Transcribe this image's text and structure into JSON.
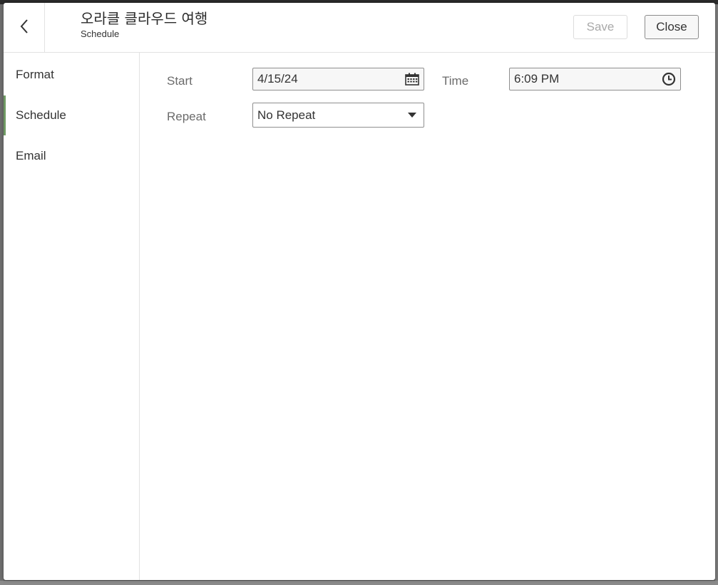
{
  "header": {
    "title": "오라클 클라우드 여행",
    "subtitle": "Schedule",
    "save_label": "Save",
    "close_label": "Close"
  },
  "sidebar": {
    "items": [
      {
        "label": "Format",
        "active": false
      },
      {
        "label": "Schedule",
        "active": true
      },
      {
        "label": "Email",
        "active": false
      }
    ]
  },
  "form": {
    "start_label": "Start",
    "start_value": "4/15/24",
    "time_label": "Time",
    "time_value": "6:09 PM",
    "repeat_label": "Repeat",
    "repeat_value": "No Repeat"
  },
  "icons": {
    "back": "chevron-left-icon",
    "calendar": "calendar-icon",
    "clock": "clock-icon",
    "dropdown": "caret-down-icon"
  },
  "colors": {
    "active_indicator": "#6f9a63",
    "save_disabled_text": "#a9a9a9"
  }
}
